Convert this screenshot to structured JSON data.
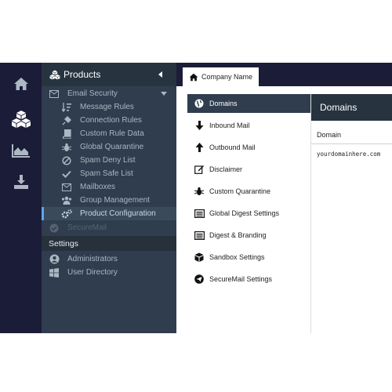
{
  "rail": {
    "items": [
      {
        "icon": "home-icon"
      },
      {
        "icon": "cubes-icon"
      },
      {
        "icon": "area-chart-icon"
      },
      {
        "icon": "download-icon"
      }
    ]
  },
  "sidebar": {
    "title": "Products",
    "email_security": "Email Security",
    "items": [
      {
        "label": "Message Rules",
        "icon": "sort-icon"
      },
      {
        "label": "Connection Rules",
        "icon": "plug-icon"
      },
      {
        "label": "Custom Rule Data",
        "icon": "book-icon"
      },
      {
        "label": "Global Quarantine",
        "icon": "bug-icon"
      },
      {
        "label": "Spam Deny List",
        "icon": "ban-icon"
      },
      {
        "label": "Spam Safe List",
        "icon": "check-icon"
      },
      {
        "label": "Mailboxes",
        "icon": "envelope-icon"
      },
      {
        "label": "Group Management",
        "icon": "users-icon"
      },
      {
        "label": "Product Configuration",
        "icon": "cogs-icon"
      }
    ],
    "securemail": "SecureMail",
    "settings_heading": "Settings",
    "settings_items": [
      {
        "label": "Administrators",
        "icon": "user-circle-icon"
      },
      {
        "label": "User Directory",
        "icon": "windows-icon"
      }
    ]
  },
  "tab": {
    "label": "Company Name"
  },
  "menu": {
    "items": [
      {
        "label": "Domains",
        "icon": "globe-icon"
      },
      {
        "label": "Inbound Mail",
        "icon": "arrow-down-icon"
      },
      {
        "label": "Outbound Mail",
        "icon": "arrow-up-icon"
      },
      {
        "label": "Disclaimer",
        "icon": "edit-icon"
      },
      {
        "label": "Custom Quarantine",
        "icon": "bug-icon"
      },
      {
        "label": "Global Digest Settings",
        "icon": "list-alt-icon"
      },
      {
        "label": "Digest & Branding",
        "icon": "list-alt-icon"
      },
      {
        "label": "Sandbox Settings",
        "icon": "cube-icon"
      },
      {
        "label": "SecureMail Settings",
        "icon": "paper-plane-icon"
      }
    ]
  },
  "panel": {
    "title": "Domains",
    "column": "Domain",
    "rows": [
      "yourdomainhere.com"
    ]
  },
  "colors": {
    "rail_bg": "#1b1c38",
    "sidebar_bg": "#2f3d4e",
    "header_bg": "#27333f",
    "active_accent": "#5aa9e6"
  }
}
